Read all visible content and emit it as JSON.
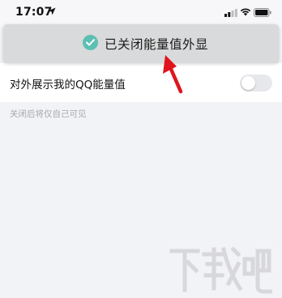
{
  "status_bar": {
    "time": "17:07",
    "icons": [
      "location-arrow-icon",
      "signal-icon",
      "wifi-icon",
      "battery-icon"
    ]
  },
  "toast": {
    "icon": "check-circle-icon",
    "icon_color": "#5dbfb3",
    "message": "已关闭能量值外显"
  },
  "setting": {
    "label": "对外展示我的QQ能量值",
    "toggle_on": false
  },
  "helper_text": "关闭后将仅自己可见",
  "annotation": {
    "type": "arrow",
    "color": "#e0141e"
  },
  "watermark": {
    "text": "下载吧"
  }
}
